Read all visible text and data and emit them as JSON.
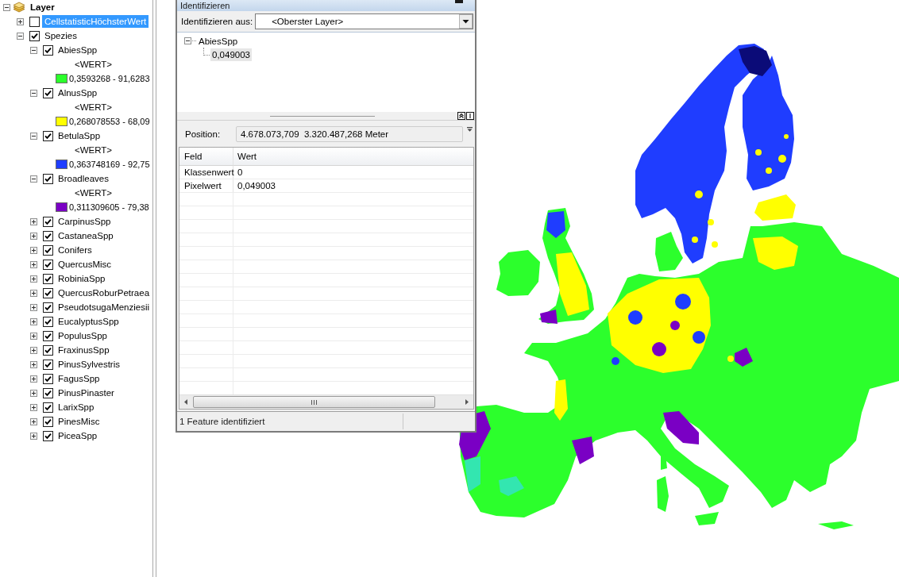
{
  "toc": {
    "label": "Layer",
    "expanded": true,
    "selected": false,
    "children": [
      {
        "label": "CellstatisticHöchsterWert",
        "checked": false,
        "expanded": false,
        "selected": true
      },
      {
        "label": "Spezies",
        "checked": true,
        "expanded": true,
        "selected": false,
        "children": [
          {
            "label": "AbiesSpp",
            "checked": true,
            "expanded": true,
            "selected": false,
            "legend": {
              "field": "<WERT>",
              "classes": [
                {
                  "color": "#2bff2b",
                  "label": "0,3593268 - 91,6283"
                }
              ]
            }
          },
          {
            "label": "AlnusSpp",
            "checked": true,
            "expanded": true,
            "selected": false,
            "legend": {
              "field": "<WERT>",
              "classes": [
                {
                  "color": "#ffff00",
                  "label": "0,268078553 - 68,09"
                }
              ]
            }
          },
          {
            "label": "BetulaSpp",
            "checked": true,
            "expanded": true,
            "selected": false,
            "legend": {
              "field": "<WERT>",
              "classes": [
                {
                  "color": "#1f3dff",
                  "label": "0,363748169 - 92,75"
                }
              ]
            }
          },
          {
            "label": "Broadleaves",
            "checked": true,
            "expanded": true,
            "selected": false,
            "legend": {
              "field": "<WERT>",
              "classes": [
                {
                  "color": "#7a00c4",
                  "label": "0,311309605 - 79,38"
                }
              ]
            }
          },
          {
            "label": "CarpinusSpp",
            "checked": true,
            "expanded": false,
            "selected": false
          },
          {
            "label": "CastaneaSpp",
            "checked": true,
            "expanded": false,
            "selected": false
          },
          {
            "label": "Conifers",
            "checked": true,
            "expanded": false,
            "selected": false
          },
          {
            "label": "QuercusMisc",
            "checked": true,
            "expanded": false,
            "selected": false
          },
          {
            "label": "RobiniaSpp",
            "checked": true,
            "expanded": false,
            "selected": false
          },
          {
            "label": "QuercusRoburPetraea",
            "checked": true,
            "expanded": false,
            "selected": false
          },
          {
            "label": "PseudotsugaMenziesii",
            "checked": true,
            "expanded": false,
            "selected": false
          },
          {
            "label": "EucalyptusSpp",
            "checked": true,
            "expanded": false,
            "selected": false
          },
          {
            "label": "PopulusSpp",
            "checked": true,
            "expanded": false,
            "selected": false
          },
          {
            "label": "FraxinusSpp",
            "checked": true,
            "expanded": false,
            "selected": false
          },
          {
            "label": "PinusSylvestris",
            "checked": true,
            "expanded": false,
            "selected": false
          },
          {
            "label": "FagusSpp",
            "checked": true,
            "expanded": false,
            "selected": false
          },
          {
            "label": "PinusPinaster",
            "checked": true,
            "expanded": false,
            "selected": false
          },
          {
            "label": "LarixSpp",
            "checked": true,
            "expanded": false,
            "selected": false
          },
          {
            "label": "PinesMisc",
            "checked": true,
            "expanded": false,
            "selected": false
          },
          {
            "label": "PiceaSpp",
            "checked": true,
            "expanded": false,
            "selected": false
          }
        ]
      }
    ]
  },
  "identify_window": {
    "title": "Identifizieren",
    "identify_from": {
      "label": "Identifizieren aus:",
      "value": "<Oberster Layer>"
    },
    "results": [
      {
        "label": "AbiesSpp",
        "expanded": true,
        "selected": false,
        "children": [
          {
            "label": "0,049003",
            "selected": true
          }
        ]
      }
    ],
    "position": {
      "label": "Position:",
      "value": "4.678.073,709  3.320.487,268 Meter"
    },
    "table": {
      "columns": [
        "Feld",
        "Wert"
      ],
      "rows": [
        [
          "Klassenwert",
          "0"
        ],
        [
          "Pixelwert",
          "0,049003"
        ]
      ]
    },
    "status": "1 Feature identifiziert"
  }
}
